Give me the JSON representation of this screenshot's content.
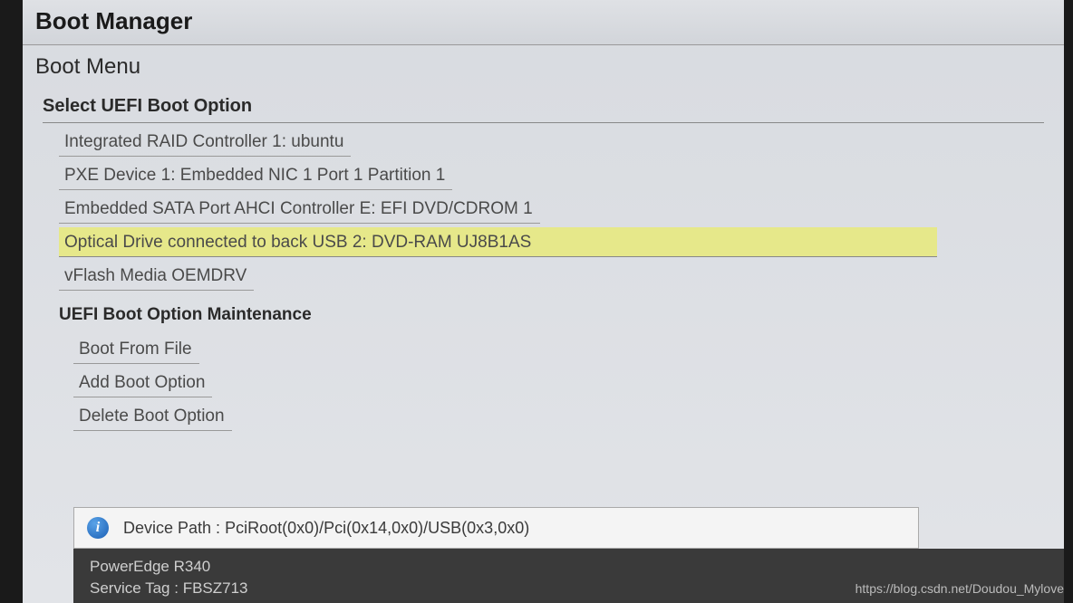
{
  "header": {
    "title": "Boot Manager",
    "subtitle": "Boot Menu"
  },
  "section": {
    "heading": "Select UEFI Boot Option",
    "options": [
      "Integrated RAID Controller 1: ubuntu",
      "PXE Device 1: Embedded NIC 1 Port 1 Partition 1",
      "Embedded SATA Port AHCI Controller E: EFI DVD/CDROM 1",
      "Optical Drive connected to back USB 2: DVD-RAM UJ8B1AS",
      "vFlash Media OEMDRV"
    ],
    "selected_index": 3
  },
  "maintenance": {
    "heading": "UEFI Boot Option Maintenance",
    "options": [
      "Boot From File",
      "Add Boot Option",
      "Delete Boot Option"
    ]
  },
  "info": {
    "label": "Device Path :",
    "value": "PciRoot(0x0)/Pci(0x14,0x0)/USB(0x3,0x0)"
  },
  "footer": {
    "model": "PowerEdge R340",
    "service_tag_label": "Service Tag :",
    "service_tag": "FBSZ713"
  },
  "watermark": "https://blog.csdn.net/Doudou_Mylove"
}
